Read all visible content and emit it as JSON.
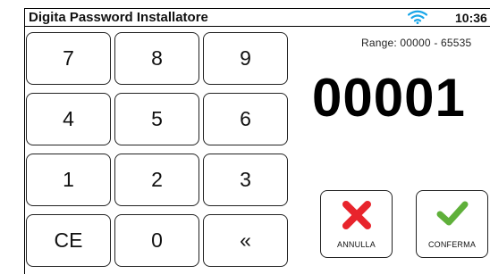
{
  "header": {
    "title": "Digita Password Installatore",
    "time": "10:36",
    "wifi_icon": "wifi-icon",
    "wifi_color": "#1aa6e8"
  },
  "keypad": {
    "keys": [
      "7",
      "8",
      "9",
      "4",
      "5",
      "6",
      "1",
      "2",
      "3",
      "CE",
      "0",
      "«"
    ]
  },
  "display": {
    "range": "Range: 00000 - 65535",
    "value": "00001"
  },
  "actions": {
    "cancel": {
      "label": "ANNULLA",
      "icon": "red-x-icon",
      "color": "#e8242c"
    },
    "confirm": {
      "label": "CONFERMA",
      "icon": "green-check-icon",
      "color": "#5fb03a"
    }
  }
}
